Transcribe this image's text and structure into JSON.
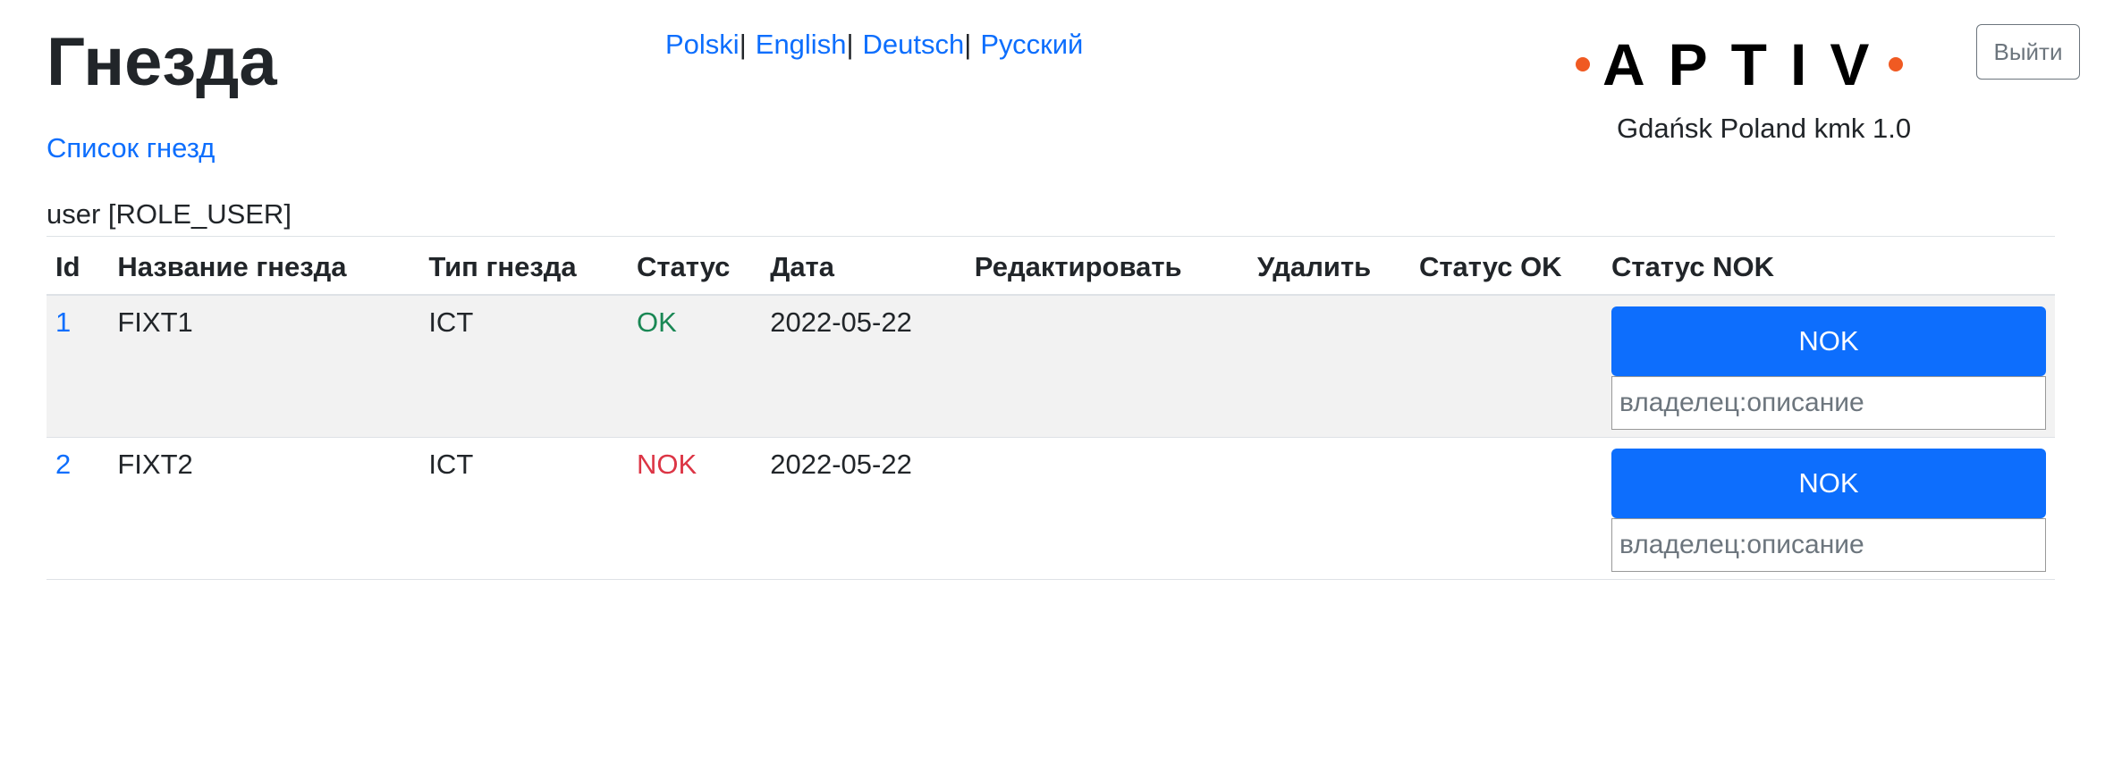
{
  "header": {
    "title": "Гнезда",
    "fixture_list_link": "Список гнезд",
    "user_info": "user [ROLE_USER]",
    "logout_label": "Выйти"
  },
  "languages": [
    {
      "label": "Polski",
      "sep": "|"
    },
    {
      "label": "English",
      "sep": "|"
    },
    {
      "label": "Deutsch",
      "sep": "|"
    },
    {
      "label": "Русский",
      "sep": ""
    }
  ],
  "brand": {
    "logo_text": "APTIV",
    "logo_dot_color": "#f05a22",
    "site_info": "Gdańsk Poland kmk 1.0"
  },
  "table": {
    "columns": [
      "Id",
      "Название гнезда",
      "Тип гнезда",
      "Статус",
      "Дата",
      "Редактировать",
      "Удалить",
      "Статус OK",
      "Статус NOK"
    ],
    "rows": [
      {
        "id": "1",
        "name": "FIXT1",
        "type": "ICT",
        "status": "OK",
        "status_color": "#198754",
        "date": "2022-05-22",
        "edit": "",
        "delete": "",
        "ok_action": "",
        "nok_button": "NOK",
        "nok_placeholder": "владелец:описание"
      },
      {
        "id": "2",
        "name": "FIXT2",
        "type": "ICT",
        "status": "NOK",
        "status_color": "#dc3545",
        "date": "2022-05-22",
        "edit": "",
        "delete": "",
        "ok_action": "",
        "nok_button": "NOK",
        "nok_placeholder": "владелец:описание"
      }
    ]
  },
  "colors": {
    "link": "#0d6efd",
    "primary_button": "#0d6efd",
    "status_ok": "#198754",
    "status_nok": "#dc3545"
  }
}
